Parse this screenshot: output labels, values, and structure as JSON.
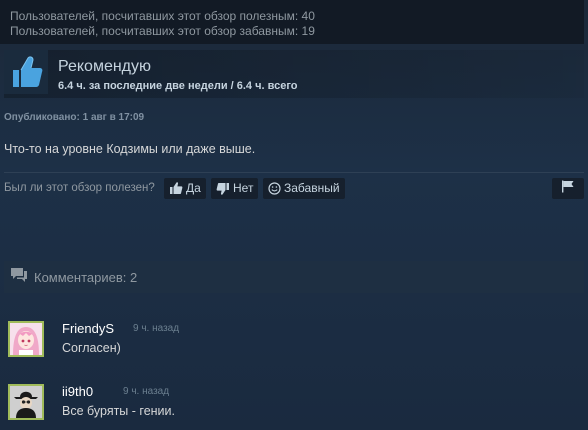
{
  "stats": {
    "helpful_line": "Пользователей, посчитавших этот обзор полезным: 40",
    "funny_line": "Пользователей, посчитавших этот обзор забавным: 19"
  },
  "recommendation": {
    "label": "Рекомендую",
    "hours": "6.4 ч. за последние две недели / 6.4 ч. всего",
    "icon": "thumbs-up-icon"
  },
  "review": {
    "posted": "Опубликовано: 1 авг в 17:09",
    "text": "Что-то на уровне Кодзимы или даже выше."
  },
  "voting": {
    "question": "Был ли этот обзор полезен?",
    "yes_label": "Да",
    "no_label": "Нет",
    "funny_label": "Забавный"
  },
  "comments": {
    "header": "Комментариев: 2",
    "items": [
      {
        "author": "FriendyS",
        "time": "9 ч. назад",
        "text": "Согласен)"
      },
      {
        "author": "ii9th0",
        "time": "9 ч. назад",
        "text": "Все буряты - гении."
      }
    ]
  },
  "colors": {
    "background": "#1b2838",
    "avatar_frame": "#a0bb5a",
    "thumb_blue": "#4aa3df"
  }
}
